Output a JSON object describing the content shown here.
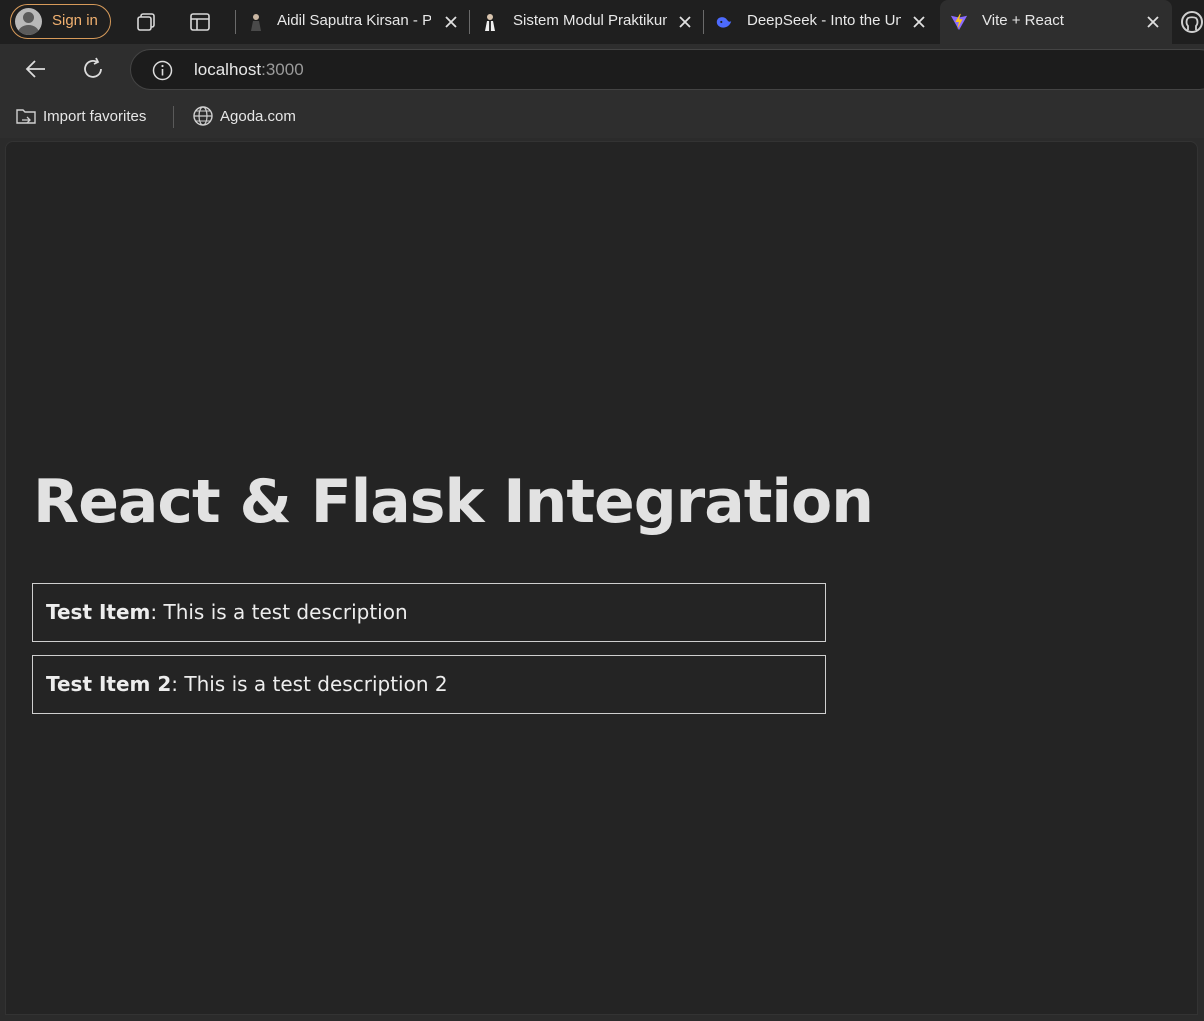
{
  "browser": {
    "signin_label": "Sign in",
    "tabs": [
      {
        "title": "Aidil Saputra Kirsan - P",
        "favicon": "person-icon",
        "active": false
      },
      {
        "title": "Sistem Modul Praktikum",
        "favicon": "person-icon",
        "active": false
      },
      {
        "title": "DeepSeek - Into the Un",
        "favicon": "deepseek-whale-icon",
        "active": false
      },
      {
        "title": "Vite + React",
        "favicon": "vite-icon",
        "active": true
      }
    ],
    "address": {
      "host": "localhost",
      "port": ":3000"
    },
    "favorites": [
      {
        "label": "Import favorites",
        "icon": "import-folder-icon"
      },
      {
        "label": "Agoda.com",
        "icon": "globe-icon"
      }
    ],
    "colors": {
      "accent": "#d69a5a",
      "tab_bg": "#1f1f1f",
      "page_bg": "#242424"
    }
  },
  "page": {
    "heading": "React & Flask Integration",
    "items": [
      {
        "name": "Test Item",
        "description": ": This is a test description"
      },
      {
        "name": "Test Item 2",
        "description": ": This is a test description 2"
      }
    ]
  }
}
